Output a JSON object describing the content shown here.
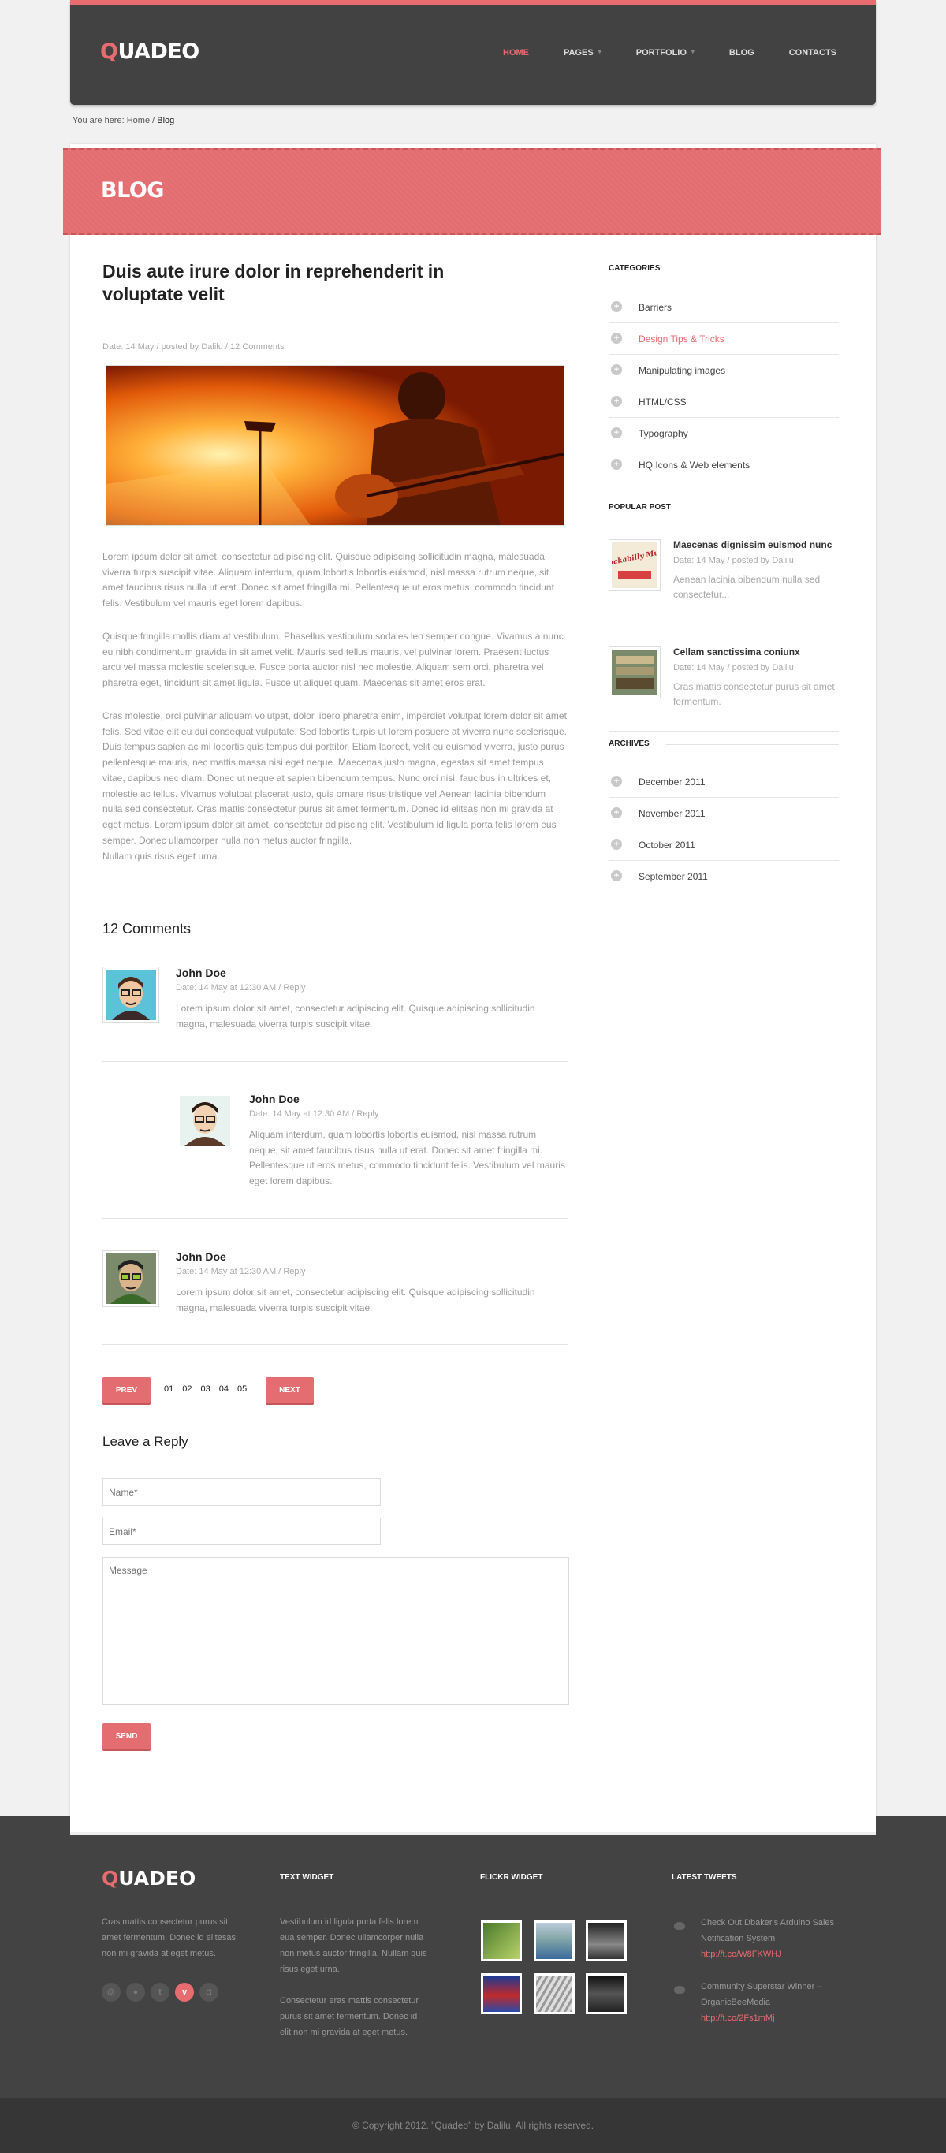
{
  "header": {
    "logo_q": "Q",
    "logo_rest": "UADEO",
    "nav": [
      {
        "label": "HOME",
        "active": true
      },
      {
        "label": "PAGES",
        "caret": true
      },
      {
        "label": "PORTFOLIO",
        "caret": true
      },
      {
        "label": "BLOG"
      },
      {
        "label": "CONTACTS"
      }
    ]
  },
  "breadcrumb": {
    "prefix": "You are here:",
    "home": "Home",
    "sep": "/",
    "current": "Blog"
  },
  "banner": {
    "title": "BLOG"
  },
  "post": {
    "title": "Duis aute irure dolor in reprehenderit in voluptate velit",
    "meta": "Date: 14 May  / posted by Dalilu / 12 Comments",
    "paragraphs": [
      "Lorem ipsum dolor sit amet, consectetur adipiscing elit. Quisque adipiscing sollicitudin magna, malesuada viverra turpis suscipit vitae. Aliquam interdum, quam lobortis lobortis euismod, nisl massa rutrum neque, sit amet faucibus risus nulla ut erat. Donec sit amet fringilla mi. Pellentesque ut eros metus, commodo tincidunt felis. Vestibulum vel mauris eget lorem dapibus.",
      "Quisque fringilla mollis diam at vestibulum. Phasellus vestibulum sodales leo semper congue. Vivamus a nunc eu nibh condimentum gravida in sit amet velit. Mauris sed tellus mauris, vel pulvinar lorem. Praesent luctus arcu vel massa molestie scelerisque. Fusce porta auctor nisl nec molestie. Aliquam sem orci, pharetra vel pharetra eget, tincidunt sit amet ligula. Fusce ut aliquet quam. Maecenas sit amet eros erat.",
      "Cras molestie, orci pulvinar aliquam volutpat, dolor libero pharetra enim, imperdiet volutpat lorem dolor sit amet felis. Sed vitae elit eu dui consequat vulputate. Sed lobortis turpis ut lorem posuere at viverra nunc scelerisque. Duis tempus sapien ac mi lobortis quis tempus dui porttitor. Etiam laoreet, velit eu euismod viverra, justo purus pellentesque mauris, nec mattis massa nisi eget neque. Maecenas justo magna, egestas sit amet tempus vitae, dapibus nec diam. Donec ut neque at sapien bibendum tempus. Nunc orci nisi, faucibus in ultrices et, molestie ac tellus. Vivamus volutpat placerat justo, quis ornare risus tristique vel.Aenean lacinia bibendum nulla sed consectetur. Cras mattis consectetur purus sit amet fermentum. Donec id elitsas non mi gravida at eget metus. Lorem ipsum dolor sit amet, consectetur adipiscing elit. Vestibulum id ligula porta felis lorem eus semper. Donec ullamcorper nulla non metus auctor fringilla.",
      "Nullam quis risus eget urna."
    ]
  },
  "comments": {
    "heading": "12 Comments",
    "items": [
      {
        "name": "John Doe",
        "meta": "Date: 14 May at 12:30 AM / Reply",
        "text": "Lorem ipsum dolor sit amet, consectetur adipiscing elit. Quisque adipiscing sollicitudin magna, malesuada viverra turpis suscipit vitae."
      },
      {
        "name": "John Doe",
        "meta": "Date: 14 May at 12:30 AM / Reply",
        "text": "Aliquam interdum, quam lobortis lobortis euismod, nisl massa rutrum neque, sit amet faucibus risus nulla ut erat. Donec sit amet fringilla mi. Pellentesque ut eros metus, commodo tincidunt felis. Vestibulum vel mauris eget lorem dapibus."
      },
      {
        "name": "John Doe",
        "meta": "Date: 14 May at 12:30 AM / Reply",
        "text": "Lorem ipsum dolor sit amet, consectetur adipiscing elit. Quisque adipiscing sollicitudin magna, malesuada viverra turpis suscipit vitae."
      }
    ]
  },
  "pagination": {
    "prev": "PREV",
    "next": "NEXT",
    "pages": [
      "01",
      "02",
      "03",
      "04",
      "05"
    ],
    "active_page": "01"
  },
  "reply": {
    "heading": "Leave a Reply",
    "name_placeholder": "Name*",
    "email_placeholder": "Email*",
    "message_placeholder": "Message",
    "send": "SEND"
  },
  "sidebar": {
    "categories_head": "CATEGORIES",
    "categories": [
      "Barriers",
      "Design Tips & Tricks",
      "Manipulating images",
      "HTML/CSS",
      "Typography",
      "HQ Icons & Web elements"
    ],
    "categories_highlight_index": 1,
    "popular_head": "POPULAR POST",
    "popular": [
      {
        "title": "Maecenas dignissim euismod nunc",
        "meta": "Date: 14 May  / posted by Dalilu",
        "text": "Aenean lacinia bibendum nulla sed consectetur...",
        "thumb_text": "Rockabilly Musi"
      },
      {
        "title": "Cellam sanctissima coniunx",
        "meta": "Date: 14 May  / posted by Dalilu",
        "text": "Cras mattis consectetur purus sit amet fermentum."
      }
    ],
    "archives_head": "ARCHIVES",
    "archives": [
      "December 2011",
      "November 2011",
      "October 2011",
      "September 2011"
    ]
  },
  "footer": {
    "logo_q": "Q",
    "logo_rest": "UADEO",
    "about": "Cras mattis consectetur purus sit amet fermentum. Donec id elitesas non mi gravida at eget metus.",
    "social_icons": [
      "dribbble-icon",
      "flickr-icon",
      "tumblr-icon",
      "vimeo-icon",
      "instagram-icon"
    ],
    "text_widget_head": "TEXT WIDGET",
    "text_widget_p1": "Vestibulum id ligula porta felis lorem eua semper. Donec ullamcorper nulla non metus auctor fringilla. Nullam quis risus eget urna.",
    "text_widget_p2": "Consectetur eras mattis consectetur purus sit amet fermentum. Donec id elit non mi gravida at eget metus.",
    "flickr_head": "FLICKR WIDGET",
    "tweets_head": "LATEST TWEETS",
    "tweets": [
      {
        "text": "Check Out Dbaker's Arduino Sales Notification System",
        "link": "http://t.co/W8FKWHJ"
      },
      {
        "text": "Community Superstar Winner – OrganicBeeMedia",
        "link": "http://t.co/2Fs1mMj"
      }
    ],
    "copyright": "© Copyright 2012. \"Quadeo\" by Dalilu. All rights reserved."
  },
  "colors": {
    "accent": "#e66c70",
    "header_bg": "#424242",
    "footer_bg": "#434343"
  }
}
